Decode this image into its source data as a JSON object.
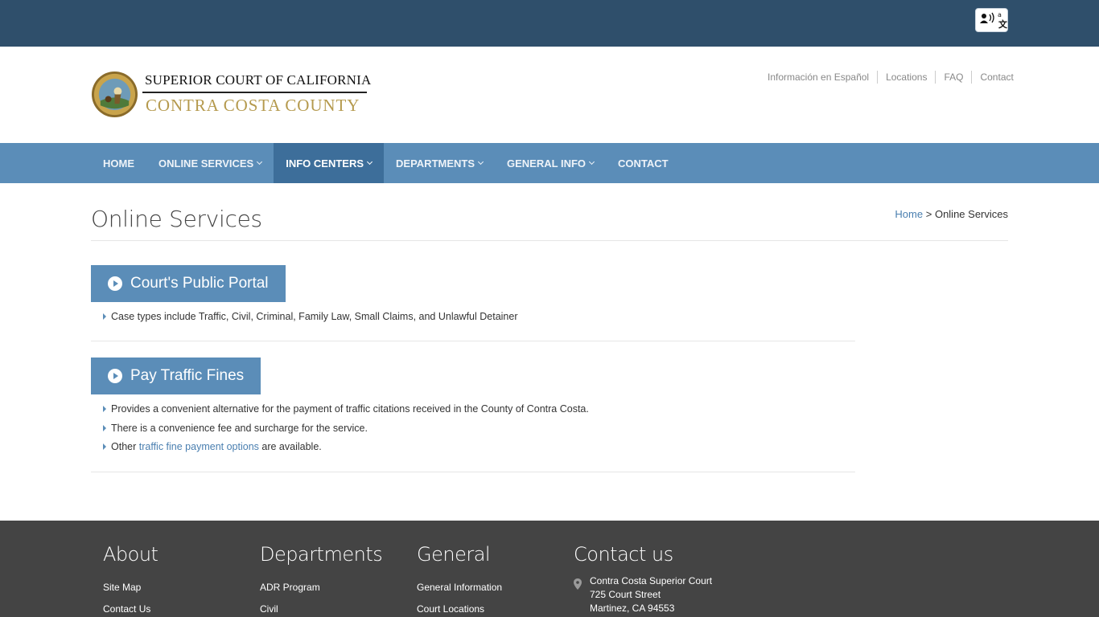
{
  "colors": {
    "topbar": "#2f4f6b",
    "nav": "#5b8db8",
    "nav_active": "#3d6e9a",
    "link": "#4a7fb0",
    "gold": "#b59a4e",
    "footer": "#444444"
  },
  "topbar": {
    "translate_icon": "translate-icon"
  },
  "logo": {
    "line1": "SUPERIOR COURT OF CALIFORNIA",
    "line2": "CONTRA COSTA COUNTY",
    "seal_icon": "state-seal-icon"
  },
  "utility_nav": [
    {
      "label": "Información en Español"
    },
    {
      "label": "Locations"
    },
    {
      "label": "FAQ"
    },
    {
      "label": "Contact"
    }
  ],
  "main_nav": [
    {
      "label": "HOME",
      "dropdown": false,
      "active": false
    },
    {
      "label": "ONLINE SERVICES",
      "dropdown": true,
      "active": false
    },
    {
      "label": "INFO CENTERS",
      "dropdown": true,
      "active": true
    },
    {
      "label": "DEPARTMENTS",
      "dropdown": true,
      "active": false
    },
    {
      "label": "GENERAL INFO",
      "dropdown": true,
      "active": false
    },
    {
      "label": "CONTACT",
      "dropdown": false,
      "active": false
    }
  ],
  "page": {
    "title": "Online Services",
    "breadcrumb": {
      "home": "Home",
      "separator": ">",
      "current": "Online Services"
    }
  },
  "services": [
    {
      "label": "Court's Public Portal",
      "bullets": [
        {
          "text": "Case types include Traffic, Civil, Criminal, Family Law, Small Claims, and Unlawful Detainer"
        }
      ]
    },
    {
      "label": "Pay Traffic Fines",
      "bullets": [
        {
          "text": "Provides a convenient alternative for the payment of traffic citations received in the County of Contra Costa."
        },
        {
          "text": "There is a convenience fee and surcharge for the service."
        },
        {
          "pre": "Other ",
          "link": "traffic fine payment options",
          "post": " are available."
        }
      ]
    }
  ],
  "footer": {
    "about": {
      "heading": "About",
      "links": [
        "Site Map",
        "Contact Us"
      ]
    },
    "departments": {
      "heading": "Departments",
      "links": [
        "ADR Program",
        "Civil"
      ]
    },
    "general": {
      "heading": "General",
      "links": [
        "General Information",
        "Court Locations"
      ]
    },
    "contact": {
      "heading": "Contact us",
      "lines": [
        "Contra Costa Superior Court",
        "725 Court Street",
        "Martinez, CA 94553"
      ],
      "icon": "location-pin-icon"
    }
  }
}
